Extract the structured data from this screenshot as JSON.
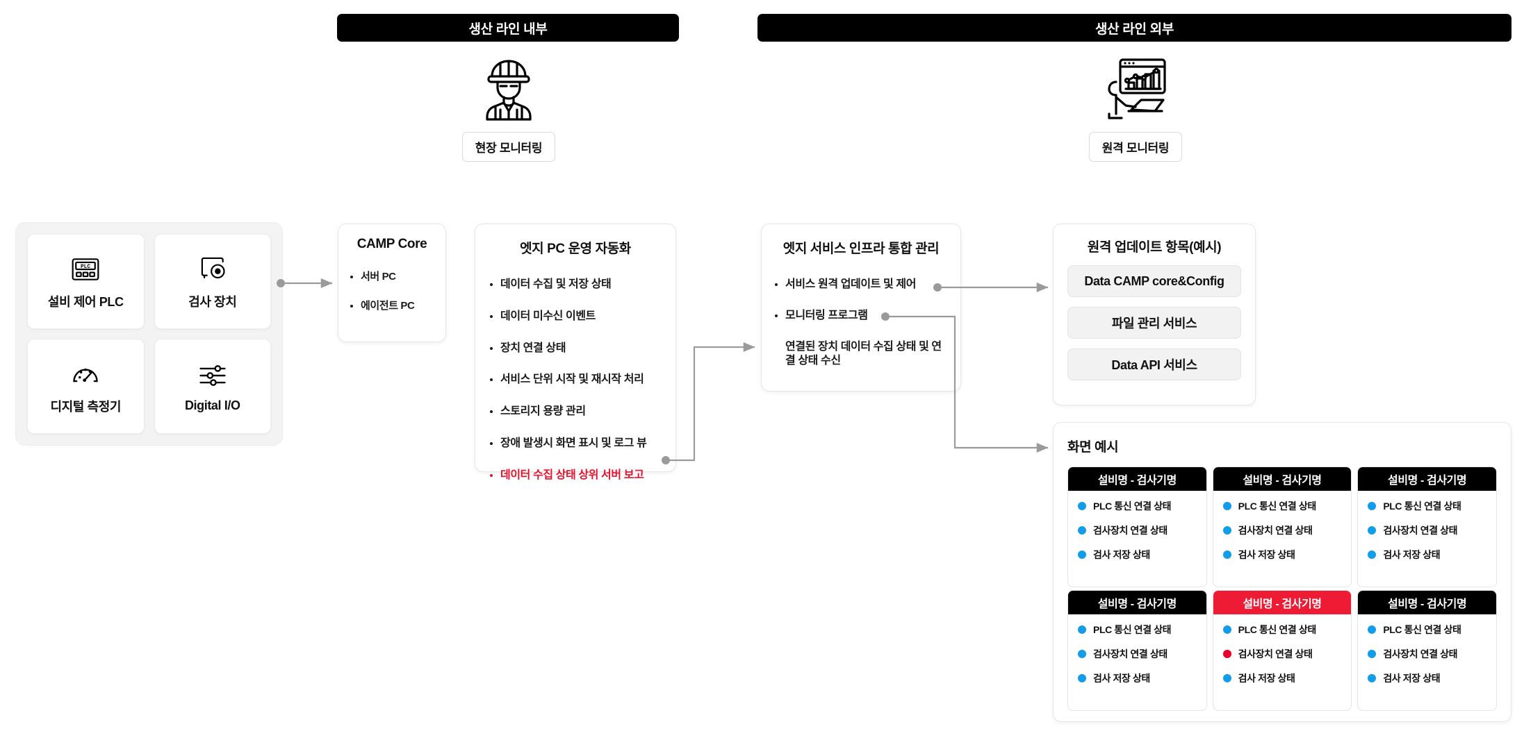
{
  "sections": {
    "inside": {
      "title": "생산 라인 내부"
    },
    "outside": {
      "title": "생산 라인 외부"
    }
  },
  "personas": {
    "site": {
      "label": "현장 모니터링",
      "icon": "worker-hardhat-icon"
    },
    "remote": {
      "label": "원격 모니터링",
      "icon": "remote-dashboard-icon"
    }
  },
  "devices": {
    "items": [
      {
        "label": "설비 제어 PLC",
        "icon": "plc-controller-icon"
      },
      {
        "label": "검사 장치",
        "icon": "inspection-camera-icon"
      },
      {
        "label": "디지털 측정기",
        "icon": "gauge-meter-icon"
      },
      {
        "label": "Digital I/O",
        "icon": "sliders-io-icon"
      }
    ]
  },
  "camp_core": {
    "title": "CAMP Core",
    "items": [
      "서버 PC",
      "에이전트 PC"
    ]
  },
  "edge_pc": {
    "title": "엣지 PC 운영 자동화",
    "items": [
      {
        "label": "데이터 수집 및 저장 상태",
        "highlight": false
      },
      {
        "label": "데이터 미수신 이벤트",
        "highlight": false
      },
      {
        "label": "장치 연결 상태",
        "highlight": false
      },
      {
        "label": "서비스 단위 시작 및 재시작 처리",
        "highlight": false
      },
      {
        "label": "스토리지 용량 관리",
        "highlight": false
      },
      {
        "label": "장애 발생시 화면 표시 및 로그 뷰",
        "highlight": false
      },
      {
        "label": "데이터 수집 상태 상위 서버 보고",
        "highlight": true
      }
    ]
  },
  "edge_infra": {
    "title": "엣지 서비스 인프라 통합 관리",
    "items": [
      {
        "label": "서비스 원격 업데이트 및 제어",
        "bullet": true
      },
      {
        "label": "모니터링 프로그램",
        "bullet": true
      },
      {
        "label": "연결된 장치 데이터 수집 상태 및 연결 상태 수신",
        "bullet": false
      }
    ]
  },
  "remote_update": {
    "title": "원격 업데이트 항목(예시)",
    "buttons": [
      "Data CAMP core&Config",
      "파일 관리 서비스",
      "Data API 서비스"
    ]
  },
  "screen_example": {
    "title": "화면 예시",
    "cards": [
      {
        "header": "설비명 - 검사기명",
        "alarm": false,
        "rows": [
          {
            "label": "PLC 통신 연결 상태",
            "state": "ok"
          },
          {
            "label": "검사장치 연결 상태",
            "state": "ok"
          },
          {
            "label": "검사 저장 상태",
            "state": "ok"
          }
        ]
      },
      {
        "header": "설비명 - 검사기명",
        "alarm": false,
        "rows": [
          {
            "label": "PLC 통신 연결 상태",
            "state": "ok"
          },
          {
            "label": "검사장치 연결 상태",
            "state": "ok"
          },
          {
            "label": "검사 저장 상태",
            "state": "ok"
          }
        ]
      },
      {
        "header": "설비명 - 검사기명",
        "alarm": false,
        "rows": [
          {
            "label": "PLC 통신 연결 상태",
            "state": "ok"
          },
          {
            "label": "검사장치 연결 상태",
            "state": "ok"
          },
          {
            "label": "검사 저장 상태",
            "state": "ok"
          }
        ]
      },
      {
        "header": "설비명 - 검사기명",
        "alarm": false,
        "rows": [
          {
            "label": "PLC 통신 연결 상태",
            "state": "ok"
          },
          {
            "label": "검사장치 연결 상태",
            "state": "ok"
          },
          {
            "label": "검사 저장 상태",
            "state": "ok"
          }
        ]
      },
      {
        "header": "설비명 - 검사기명",
        "alarm": true,
        "rows": [
          {
            "label": "PLC 통신 연결 상태",
            "state": "ok"
          },
          {
            "label": "검사장치 연결 상태",
            "state": "error"
          },
          {
            "label": "검사 저장 상태",
            "state": "ok"
          }
        ]
      },
      {
        "header": "설비명 - 검사기명",
        "alarm": false,
        "rows": [
          {
            "label": "PLC 통신 연결 상태",
            "state": "ok"
          },
          {
            "label": "검사장치 연결 상태",
            "state": "ok"
          },
          {
            "label": "검사 저장 상태",
            "state": "ok"
          }
        ]
      }
    ]
  },
  "colors": {
    "header_bar": "#000000",
    "alarm_red": "#ed1b33",
    "highlight_red": "#e8112d",
    "status_ok": "#129cea",
    "status_error": "#e8002a",
    "connector": "#9a9a9a",
    "panel_bg": "#f3f3f3"
  }
}
